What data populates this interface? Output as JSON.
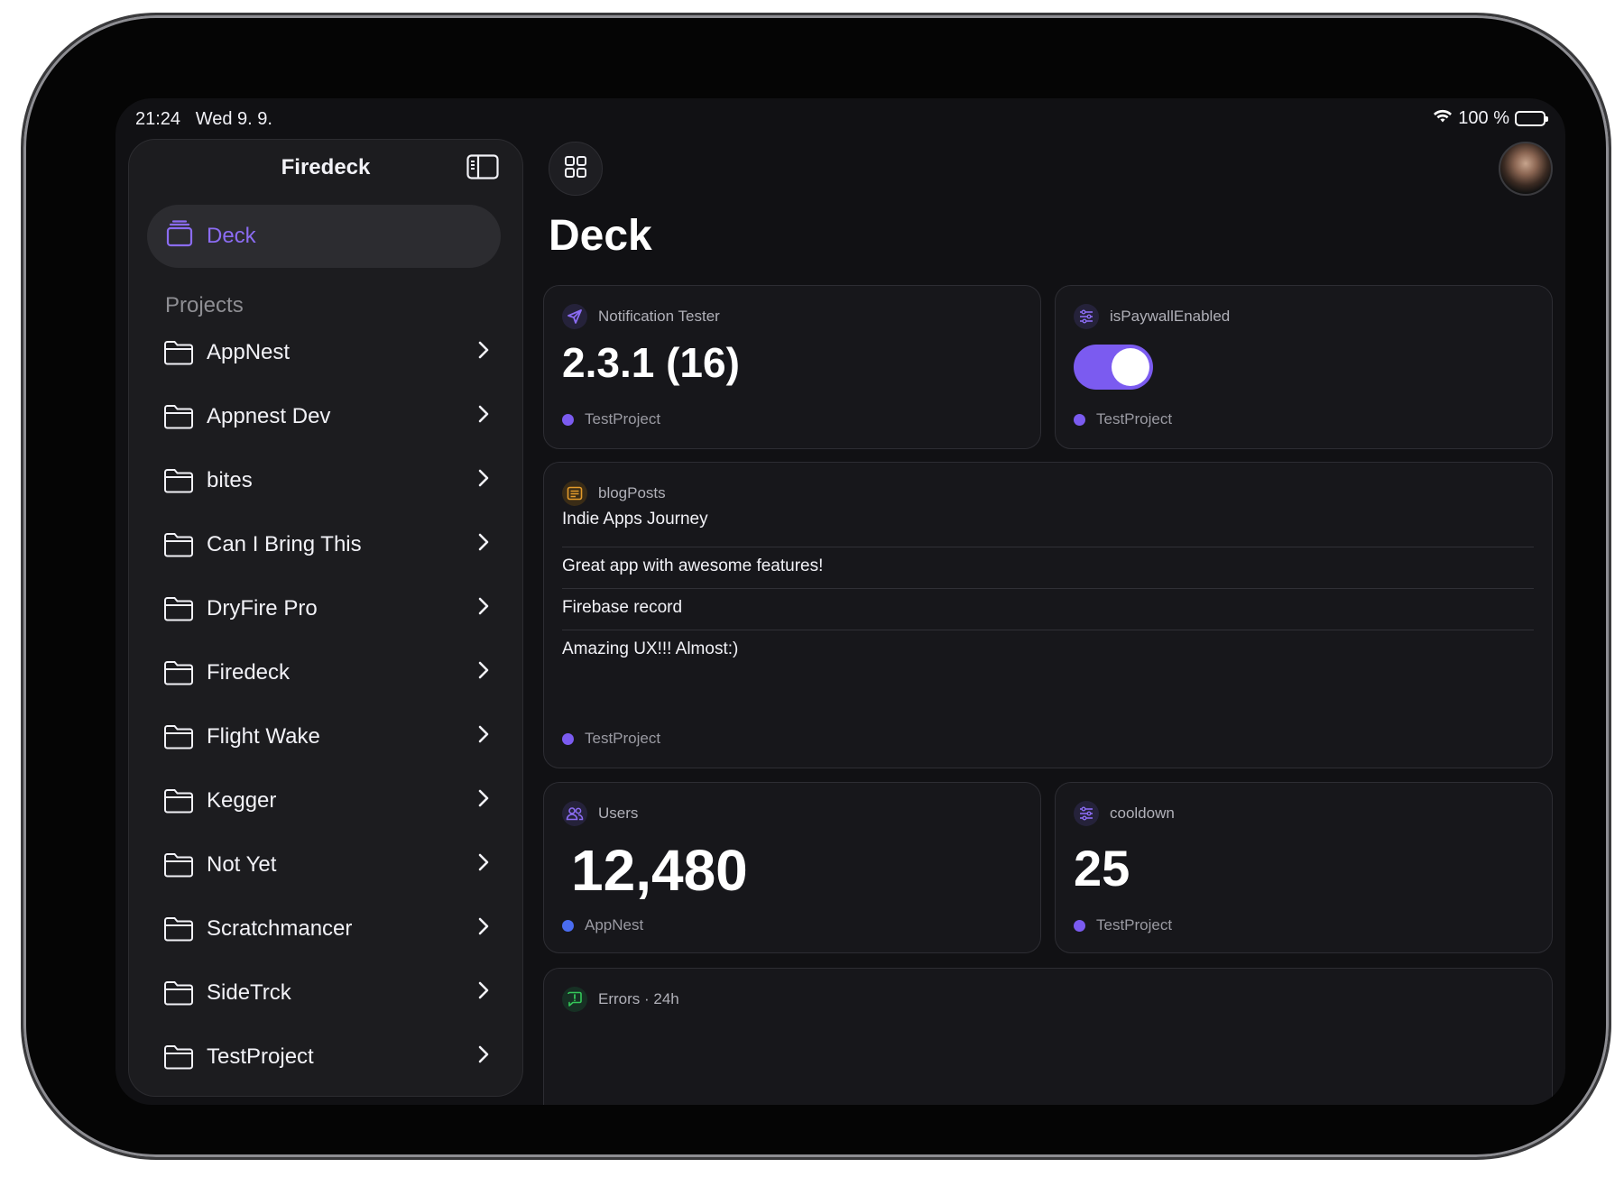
{
  "status": {
    "time": "21:24",
    "date": "Wed 9. 9.",
    "battery": "100 %"
  },
  "sidebar": {
    "title": "Firedeck",
    "deck_label": "Deck",
    "projects_label": "Projects",
    "projects": [
      "AppNest",
      "Appnest Dev",
      "bites",
      "Can I Bring This",
      "DryFire Pro",
      "Firedeck",
      "Flight Wake",
      "Kegger",
      "Not Yet",
      "Scratchmancer",
      "SideTrck",
      "TestProject"
    ]
  },
  "main": {
    "title": "Deck",
    "cards": {
      "notification": {
        "label": "Notification Tester",
        "value": "2.3.1 (16)",
        "project": "TestProject"
      },
      "paywall": {
        "label": "isPaywallEnabled",
        "toggle_on": true,
        "project": "TestProject"
      },
      "blog": {
        "label": "blogPosts",
        "rows": [
          "Indie Apps Journey",
          "Great app with awesome features!",
          "Firebase record",
          "Amazing UX!!! Almost:)"
        ],
        "project": "TestProject"
      },
      "users": {
        "label": "Users",
        "value": "12,480",
        "project": "AppNest"
      },
      "cooldown": {
        "label": "cooldown",
        "value": "25",
        "project": "TestProject"
      },
      "errors": {
        "label": "Errors · 24h"
      }
    }
  },
  "colors": {
    "accent": "#7b5bf0",
    "blue_dot": "#4a6cf0",
    "orange": "#e39b2b",
    "green": "#34c759"
  }
}
